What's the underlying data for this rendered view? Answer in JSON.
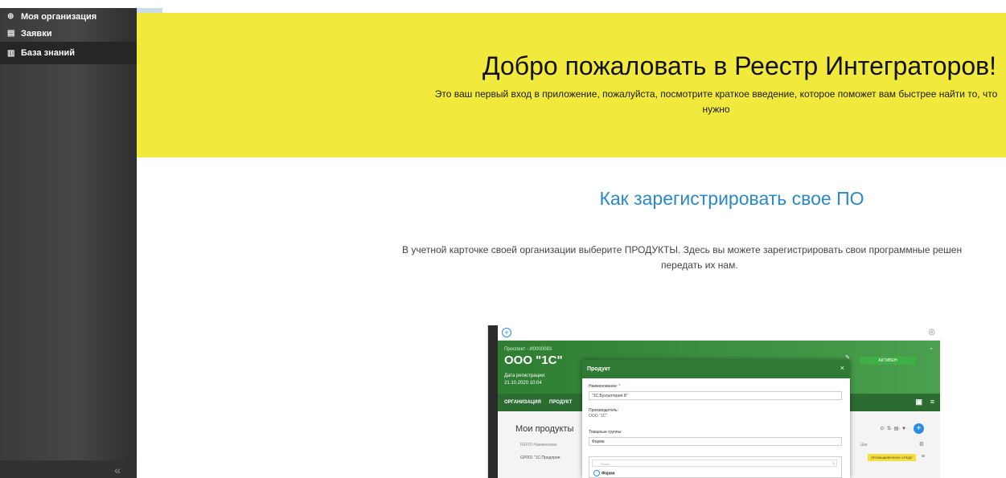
{
  "sidebar": {
    "items": [
      {
        "icon": "box-icon",
        "label": "Моя организация"
      },
      {
        "icon": "clipboard-icon",
        "label": "Заявки"
      },
      {
        "icon": "book-icon",
        "label": "База знаний"
      }
    ],
    "collapse_label": "«"
  },
  "banner": {
    "title": "Добро пожаловать в Реестр Интеграторов!",
    "subtitle": "Это ваш первый вход в приложение, пожалуйста, посмотрите краткое введение, которое поможет вам быстрее найти то, что нужно",
    "background": "#f2e93d"
  },
  "section": {
    "title": "Как зарегистрировать свое ПО",
    "text_line1": "В учетной карточке своей организации выберите ПРОДУКТЫ. Здесь вы можете зарегистрировать свои программные решен",
    "text_line2": "передать их нам.",
    "title_color": "#2b88c8"
  },
  "screenshot": {
    "prospect_id": "Проспект - И0000083",
    "org_name": "ООО \"1С\"",
    "reg_label": "Дата регистрации:",
    "reg_date": "21.10.2020 10:04",
    "status": "АКТИВЕН",
    "tabs": [
      "ОРГАНИЗАЦИЯ",
      "ПРОДУКТ"
    ],
    "products_title": "Мои продукты",
    "table_header": "REFID   Наименован",
    "table_row": "GP001   \"1С:Предприя",
    "col_step": "Шаг",
    "row_status": "ПРОМЫШЛЕННУЮ СРЕДУ",
    "dialog": {
      "title": "Продукт",
      "name_label": "Наименование:",
      "name_value": "\"1С:Бухгалтерия 8\"",
      "vendor_label": "Производитель:",
      "vendor_value": "ООО \"1С\"",
      "groups_label": "Товарные группы:",
      "groups_value": "Фарма",
      "search_placeholder": "Поиск...",
      "option": "Фарма"
    }
  }
}
